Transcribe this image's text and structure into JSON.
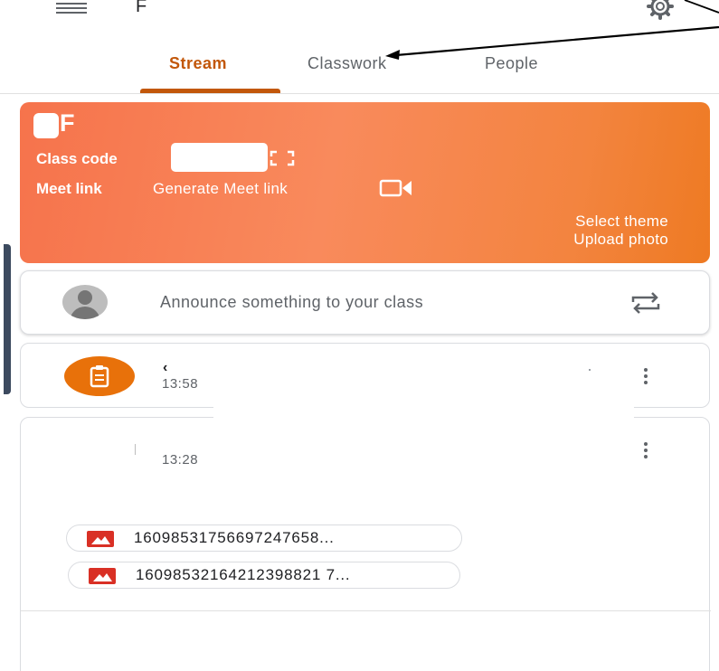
{
  "header": {
    "class_title": "F",
    "menu_icon": "menu-icon",
    "settings_icon": "gear-icon"
  },
  "tabs": [
    {
      "label": "Stream",
      "active": true
    },
    {
      "label": "Classwork",
      "active": false
    },
    {
      "label": "People",
      "active": false
    }
  ],
  "banner": {
    "title": "F",
    "class_code_label": "Class code",
    "meet_label": "Meet link",
    "meet_action": "Generate Meet link",
    "select_theme": "Select theme",
    "upload_photo": "Upload photo",
    "color": "#f6734c"
  },
  "announce": {
    "placeholder": "Announce something to your class"
  },
  "posts": [
    {
      "title": "‹",
      "time": "13:58",
      "icon": "assignment-icon"
    },
    {
      "time": "13:28",
      "attachments": [
        {
          "name": "16098531756697247658...",
          "icon": "image-icon"
        },
        {
          "name": "16098532164212398821 7...",
          "icon": "image-icon"
        }
      ]
    }
  ],
  "colors": {
    "accent": "#c2570a",
    "assignment": "#e8710a",
    "attachment": "#d93025"
  }
}
